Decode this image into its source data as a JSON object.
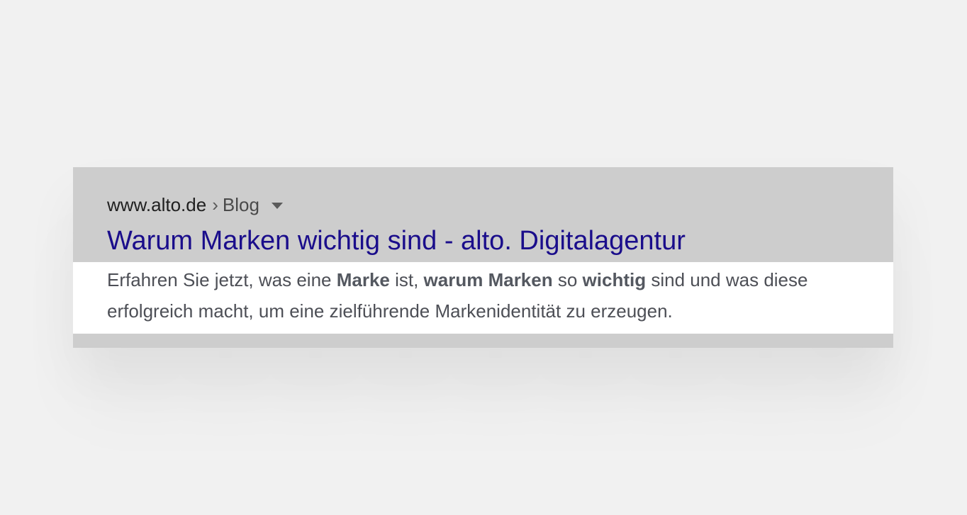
{
  "result": {
    "domain": "www.alto.de",
    "separator": "›",
    "path": "Blog",
    "title": "Warum Marken wichtig sind - alto. Digitalagentur",
    "snippet": {
      "t1": "Erfahren Sie jetzt, was eine ",
      "b1": "Marke",
      "t2": " ist, ",
      "b2": "warum Marken",
      "t3": " so ",
      "b3": "wichtig",
      "t4": " sind und was diese erfolgreich macht, um eine zielführende Markenidentität zu erzeugen."
    }
  },
  "icons": {
    "menu_caret": "caret-down-icon"
  },
  "colors": {
    "background": "#f1f1f1",
    "card": "#cdcdcd",
    "title_link": "#1a0d8b",
    "snippet_text": "#4d4f56",
    "snippet_band": "#ffffff"
  }
}
